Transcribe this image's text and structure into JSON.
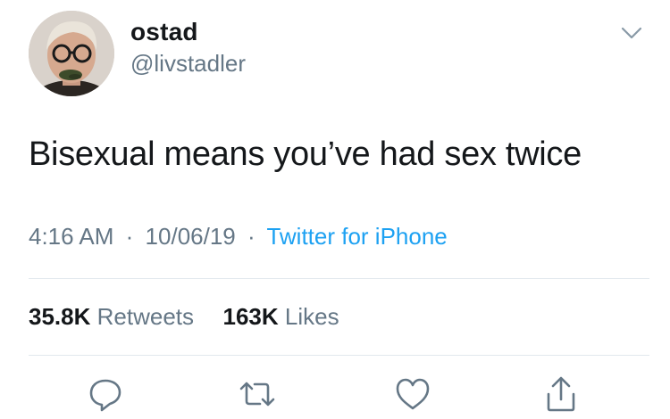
{
  "user": {
    "display_name": "ostad",
    "handle": "@livstadler",
    "avatar_icon": "profile-photo"
  },
  "tweet": {
    "text": "Bisexual means you’ve had sex twice",
    "time": "4:16 AM",
    "date": "10/06/19",
    "separator": "·",
    "source": "Twitter for iPhone"
  },
  "stats": {
    "retweets_count": "35.8K",
    "retweets_label": "Retweets",
    "likes_count": "163K",
    "likes_label": "Likes"
  },
  "actions": [
    {
      "icon": "reply-icon"
    },
    {
      "icon": "retweet-icon"
    },
    {
      "icon": "like-icon"
    },
    {
      "icon": "share-icon"
    }
  ],
  "colors": {
    "text": "#14171a",
    "secondary": "#657786",
    "link": "#1da1f2",
    "divider": "#e1e8ed"
  }
}
